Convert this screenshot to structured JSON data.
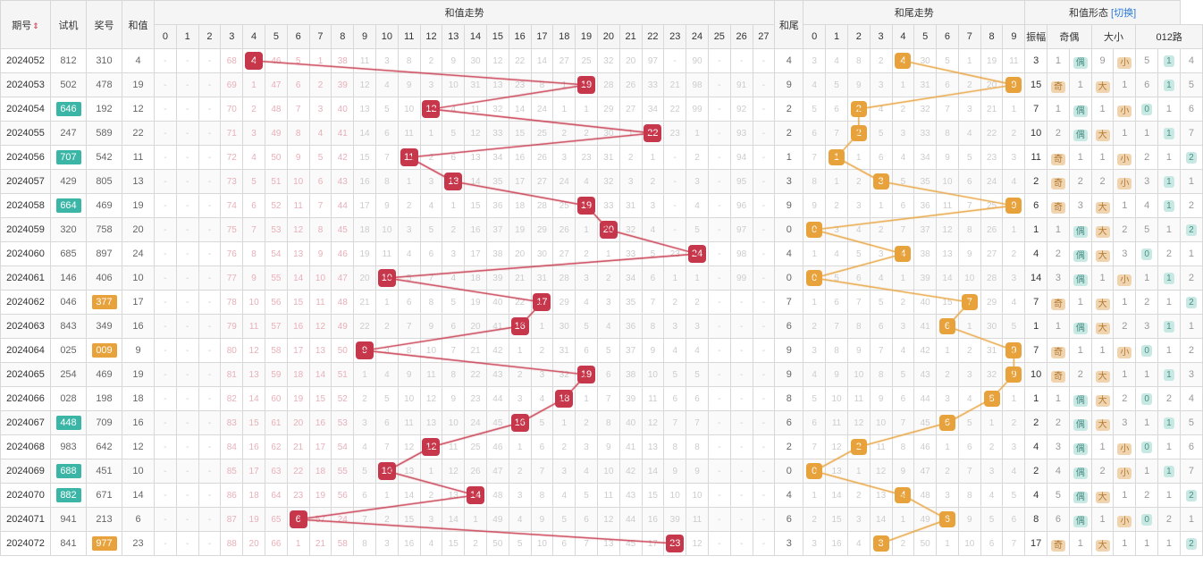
{
  "headers": {
    "period": "期号",
    "sj": "试机",
    "jh": "奖号",
    "hz": "和值",
    "hz_trend": "和值走势",
    "hw": "和尾",
    "hw_trend": "和尾走势",
    "hz_form": "和值形态",
    "switch": "[切换]",
    "zf": "振幅",
    "jo": "奇偶",
    "dx": "大小",
    "r012": "012路"
  },
  "hz_cols": [
    0,
    1,
    2,
    3,
    4,
    5,
    6,
    7,
    8,
    9,
    10,
    11,
    12,
    13,
    14,
    15,
    16,
    17,
    18,
    19,
    20,
    21,
    22,
    23,
    24,
    25,
    26,
    27
  ],
  "hw_cols": [
    0,
    1,
    2,
    3,
    4,
    5,
    6,
    7,
    8,
    9
  ],
  "chart_data": {
    "type": "table",
    "title": "和值走势 / 和尾走势 / 和值形态",
    "columns": [
      "期号",
      "试机",
      "奖号",
      "和值",
      "和尾",
      "振幅",
      "奇偶",
      "大小",
      "012路"
    ],
    "hz_range": [
      0,
      27
    ],
    "hw_range": [
      0,
      9
    ]
  },
  "rows": [
    {
      "period": "2024052",
      "sj": "812",
      "sj_hl": false,
      "jh": "310",
      "jh_hl": false,
      "hz": 4,
      "hz_cells": [
        "-",
        "-",
        "-",
        "68",
        "@4",
        "46",
        "5",
        "1",
        "38",
        "11",
        "3",
        "8",
        "2",
        "9",
        "30",
        "12",
        "22",
        "14",
        "27",
        "25",
        "32",
        "20",
        "97",
        "-",
        "90",
        "-",
        "-",
        "-"
      ],
      "hw": 4,
      "hw_cells": [
        "3",
        "4",
        "8",
        "2",
        "@4",
        "30",
        "5",
        "1",
        "19",
        "11"
      ],
      "zf": 3,
      "jo": [
        "1",
        "偶"
      ],
      "dx": [
        "9",
        "小"
      ],
      "r012": [
        "5",
        "1t",
        "4"
      ]
    },
    {
      "period": "2024053",
      "sj": "502",
      "sj_hl": false,
      "jh": "478",
      "jh_hl": false,
      "hz": 19,
      "hz_cells": [
        "-",
        "-",
        "-",
        "69",
        "1",
        "47",
        "6",
        "2",
        "39",
        "12",
        "4",
        "9",
        "3",
        "10",
        "31",
        "13",
        "23",
        "8",
        "1",
        "@19",
        "28",
        "26",
        "33",
        "21",
        "98",
        "-",
        "91",
        "-"
      ],
      "hw": 9,
      "hw_cells": [
        "4",
        "5",
        "9",
        "3",
        "1",
        "31",
        "6",
        "2",
        "20",
        "@9"
      ],
      "zf": 15,
      "jo": [
        "奇",
        "1"
      ],
      "dx": [
        "大",
        "1"
      ],
      "r012": [
        "6",
        "1t",
        "5"
      ]
    },
    {
      "period": "2024054",
      "sj": "646",
      "sj_hl": true,
      "jh": "192",
      "jh_hl": false,
      "hz": 12,
      "hz_cells": [
        "-",
        "-",
        "-",
        "70",
        "2",
        "48",
        "7",
        "3",
        "40",
        "13",
        "5",
        "10",
        "@12",
        "4",
        "11",
        "32",
        "14",
        "24",
        "1",
        "1",
        "29",
        "27",
        "34",
        "22",
        "99",
        "-",
        "92",
        "-"
      ],
      "hw": 2,
      "hw_cells": [
        "5",
        "6",
        "@2",
        "4",
        "2",
        "32",
        "7",
        "3",
        "21",
        "1"
      ],
      "zf": 7,
      "jo": [
        "1",
        "偶"
      ],
      "dx": [
        "1",
        "小"
      ],
      "r012": [
        "0t",
        "1",
        "6"
      ]
    },
    {
      "period": "2024055",
      "sj": "247",
      "sj_hl": false,
      "jh": "589",
      "jh_hl": false,
      "hz": 22,
      "hz_cells": [
        "-",
        "-",
        "-",
        "71",
        "3",
        "49",
        "8",
        "4",
        "41",
        "14",
        "6",
        "11",
        "1",
        "5",
        "12",
        "33",
        "15",
        "25",
        "2",
        "2",
        "30",
        "1",
        "@22",
        "23",
        "1",
        "-",
        "93",
        "-"
      ],
      "hw": 2,
      "hw_cells": [
        "6",
        "7",
        "@2",
        "5",
        "3",
        "33",
        "8",
        "4",
        "22",
        "2"
      ],
      "zf": 10,
      "jo": [
        "2",
        "偶"
      ],
      "dx": [
        "大",
        "1"
      ],
      "r012": [
        "1",
        "1t",
        "7"
      ]
    },
    {
      "period": "2024056",
      "sj": "707",
      "sj_hl": true,
      "jh": "542",
      "jh_hl": false,
      "hz": 11,
      "hz_cells": [
        "-",
        "-",
        "-",
        "72",
        "4",
        "50",
        "9",
        "5",
        "42",
        "15",
        "7",
        "@11",
        "2",
        "6",
        "13",
        "34",
        "16",
        "26",
        "3",
        "23",
        "31",
        "2",
        "1",
        "-",
        "2",
        "-",
        "94",
        "-"
      ],
      "hw": 1,
      "hw_cells": [
        "7",
        "@1",
        "1",
        "6",
        "4",
        "34",
        "9",
        "5",
        "23",
        "3"
      ],
      "zf": 11,
      "jo": [
        "奇",
        "1"
      ],
      "dx": [
        "1",
        "小"
      ],
      "r012": [
        "2",
        "1",
        "2t"
      ]
    },
    {
      "period": "2024057",
      "sj": "429",
      "sj_hl": false,
      "jh": "805",
      "jh_hl": false,
      "hz": 13,
      "hz_cells": [
        "-",
        "-",
        "-",
        "73",
        "5",
        "51",
        "10",
        "6",
        "43",
        "16",
        "8",
        "1",
        "3",
        "@13",
        "14",
        "35",
        "17",
        "27",
        "24",
        "4",
        "32",
        "3",
        "2",
        "-",
        "3",
        "-",
        "95",
        "-"
      ],
      "hw": 3,
      "hw_cells": [
        "8",
        "1",
        "2",
        "@3",
        "5",
        "35",
        "10",
        "6",
        "24",
        "4"
      ],
      "zf": 2,
      "jo": [
        "奇",
        "2"
      ],
      "dx": [
        "2",
        "小"
      ],
      "r012": [
        "3",
        "1t",
        "1"
      ]
    },
    {
      "period": "2024058",
      "sj": "664",
      "sj_hl": true,
      "jh": "469",
      "jh_hl": false,
      "hz": 19,
      "hz_cells": [
        "-",
        "-",
        "-",
        "74",
        "6",
        "52",
        "11",
        "7",
        "44",
        "17",
        "9",
        "2",
        "4",
        "1",
        "15",
        "36",
        "18",
        "28",
        "25",
        "@19",
        "33",
        "31",
        "3",
        "-",
        "4",
        "-",
        "96",
        "-"
      ],
      "hw": 9,
      "hw_cells": [
        "9",
        "2",
        "3",
        "1",
        "6",
        "36",
        "11",
        "7",
        "25",
        "@9"
      ],
      "zf": 6,
      "jo": [
        "奇",
        "3"
      ],
      "dx": [
        "大",
        "1"
      ],
      "r012": [
        "4",
        "1t",
        "2"
      ]
    },
    {
      "period": "2024059",
      "sj": "320",
      "sj_hl": false,
      "jh": "758",
      "jh_hl": false,
      "hz": 20,
      "hz_cells": [
        "-",
        "-",
        "-",
        "75",
        "7",
        "53",
        "12",
        "8",
        "45",
        "18",
        "10",
        "3",
        "5",
        "2",
        "16",
        "37",
        "19",
        "29",
        "26",
        "1",
        "@20",
        "32",
        "4",
        "-",
        "5",
        "-",
        "97",
        "-"
      ],
      "hw": 0,
      "hw_cells": [
        "@0",
        "3",
        "4",
        "2",
        "7",
        "37",
        "12",
        "8",
        "26",
        "1"
      ],
      "zf": 1,
      "jo": [
        "1",
        "偶"
      ],
      "dx": [
        "大",
        "2"
      ],
      "r012": [
        "5",
        "1",
        "2t"
      ]
    },
    {
      "period": "2024060",
      "sj": "685",
      "sj_hl": false,
      "jh": "897",
      "jh_hl": false,
      "hz": 24,
      "hz_cells": [
        "-",
        "-",
        "-",
        "76",
        "8",
        "54",
        "13",
        "9",
        "46",
        "19",
        "11",
        "4",
        "6",
        "3",
        "17",
        "38",
        "20",
        "30",
        "27",
        "2",
        "1",
        "33",
        "5",
        "23",
        "@24",
        "-",
        "98",
        "-"
      ],
      "hw": 4,
      "hw_cells": [
        "1",
        "4",
        "5",
        "3",
        "@4",
        "38",
        "13",
        "9",
        "27",
        "2"
      ],
      "zf": 4,
      "jo": [
        "2",
        "偶"
      ],
      "dx": [
        "大",
        "3"
      ],
      "r012": [
        "0t",
        "2",
        "1"
      ]
    },
    {
      "period": "2024061",
      "sj": "146",
      "sj_hl": false,
      "jh": "406",
      "jh_hl": false,
      "hz": 10,
      "hz_cells": [
        "-",
        "-",
        "-",
        "77",
        "9",
        "55",
        "14",
        "10",
        "47",
        "20",
        "@10",
        "5",
        "7",
        "4",
        "18",
        "39",
        "21",
        "31",
        "28",
        "3",
        "2",
        "34",
        "6",
        "1",
        "1",
        "-",
        "99",
        "-"
      ],
      "hw": 0,
      "hw_cells": [
        "@0",
        "5",
        "6",
        "4",
        "1",
        "39",
        "14",
        "10",
        "28",
        "3"
      ],
      "zf": 14,
      "jo": [
        "3",
        "偶"
      ],
      "dx": [
        "1",
        "小"
      ],
      "r012": [
        "1",
        "1t",
        "2"
      ]
    },
    {
      "period": "2024062",
      "sj": "046",
      "sj_hl": false,
      "jh": "377",
      "jh_hl": true,
      "hz": 17,
      "hz_cells": [
        "-",
        "-",
        "-",
        "78",
        "10",
        "56",
        "15",
        "11",
        "48",
        "21",
        "1",
        "6",
        "8",
        "5",
        "19",
        "40",
        "22",
        "@17",
        "29",
        "4",
        "3",
        "35",
        "7",
        "2",
        "2",
        "-",
        "-",
        "-"
      ],
      "hw": 7,
      "hw_cells": [
        "1",
        "6",
        "7",
        "5",
        "2",
        "40",
        "15",
        "@7",
        "29",
        "4"
      ],
      "zf": 7,
      "jo": [
        "奇",
        "1"
      ],
      "dx": [
        "大",
        "1"
      ],
      "r012": [
        "2",
        "1",
        "2t"
      ]
    },
    {
      "period": "2024063",
      "sj": "843",
      "sj_hl": false,
      "jh": "349",
      "jh_hl": false,
      "hz": 16,
      "hz_cells": [
        "-",
        "-",
        "-",
        "79",
        "11",
        "57",
        "16",
        "12",
        "49",
        "22",
        "2",
        "7",
        "9",
        "6",
        "20",
        "41",
        "@16",
        "1",
        "30",
        "5",
        "4",
        "36",
        "8",
        "3",
        "3",
        "-",
        "-",
        "-"
      ],
      "hw": 6,
      "hw_cells": [
        "2",
        "7",
        "8",
        "6",
        "3",
        "41",
        "@6",
        "1",
        "30",
        "5"
      ],
      "zf": 1,
      "jo": [
        "1",
        "偶"
      ],
      "dx": [
        "大",
        "2"
      ],
      "r012": [
        "3",
        "1t",
        "1"
      ]
    },
    {
      "period": "2024064",
      "sj": "025",
      "sj_hl": false,
      "jh": "009",
      "jh_hl": true,
      "hz": 9,
      "hz_cells": [
        "-",
        "-",
        "-",
        "80",
        "12",
        "58",
        "17",
        "13",
        "50",
        "@9",
        "3",
        "8",
        "10",
        "7",
        "21",
        "42",
        "1",
        "2",
        "31",
        "6",
        "5",
        "37",
        "9",
        "4",
        "4",
        "-",
        "-",
        "-"
      ],
      "hw": 9,
      "hw_cells": [
        "3",
        "8",
        "9",
        "7",
        "4",
        "42",
        "1",
        "2",
        "31",
        "@9"
      ],
      "zf": 7,
      "jo": [
        "奇",
        "1"
      ],
      "dx": [
        "1",
        "小"
      ],
      "r012": [
        "0t",
        "1",
        "2"
      ]
    },
    {
      "period": "2024065",
      "sj": "254",
      "sj_hl": false,
      "jh": "469",
      "jh_hl": false,
      "hz": 19,
      "hz_cells": [
        "-",
        "-",
        "-",
        "81",
        "13",
        "59",
        "18",
        "14",
        "51",
        "1",
        "4",
        "9",
        "11",
        "8",
        "22",
        "43",
        "2",
        "3",
        "32",
        "@19",
        "6",
        "38",
        "10",
        "5",
        "5",
        "-",
        "-",
        "-"
      ],
      "hw": 9,
      "hw_cells": [
        "4",
        "9",
        "10",
        "8",
        "5",
        "43",
        "2",
        "3",
        "32",
        "@9"
      ],
      "zf": 10,
      "jo": [
        "奇",
        "2"
      ],
      "dx": [
        "大",
        "1"
      ],
      "r012": [
        "1",
        "1t",
        "3"
      ]
    },
    {
      "period": "2024066",
      "sj": "028",
      "sj_hl": false,
      "jh": "198",
      "jh_hl": false,
      "hz": 18,
      "hz_cells": [
        "-",
        "-",
        "-",
        "82",
        "14",
        "60",
        "19",
        "15",
        "52",
        "2",
        "5",
        "10",
        "12",
        "9",
        "23",
        "44",
        "3",
        "4",
        "@18",
        "1",
        "7",
        "39",
        "11",
        "6",
        "6",
        "-",
        "-",
        "-"
      ],
      "hw": 8,
      "hw_cells": [
        "5",
        "10",
        "11",
        "9",
        "6",
        "44",
        "3",
        "4",
        "@8",
        "1"
      ],
      "zf": 1,
      "jo": [
        "1",
        "偶"
      ],
      "dx": [
        "大",
        "2"
      ],
      "r012": [
        "0t",
        "2",
        "4"
      ]
    },
    {
      "period": "2024067",
      "sj": "448",
      "sj_hl": true,
      "jh": "709",
      "jh_hl": false,
      "hz": 16,
      "hz_cells": [
        "-",
        "-",
        "-",
        "83",
        "15",
        "61",
        "20",
        "16",
        "53",
        "3",
        "6",
        "11",
        "13",
        "10",
        "24",
        "45",
        "@16",
        "5",
        "1",
        "2",
        "8",
        "40",
        "12",
        "7",
        "7",
        "-",
        "-",
        "-"
      ],
      "hw": 6,
      "hw_cells": [
        "6",
        "11",
        "12",
        "10",
        "7",
        "45",
        "@6",
        "5",
        "1",
        "2"
      ],
      "zf": 2,
      "jo": [
        "2",
        "偶"
      ],
      "dx": [
        "大",
        "3"
      ],
      "r012": [
        "1",
        "1t",
        "5"
      ]
    },
    {
      "period": "2024068",
      "sj": "983",
      "sj_hl": false,
      "jh": "642",
      "jh_hl": false,
      "hz": 12,
      "hz_cells": [
        "-",
        "-",
        "-",
        "84",
        "16",
        "62",
        "21",
        "17",
        "54",
        "4",
        "7",
        "12",
        "@12",
        "11",
        "25",
        "46",
        "1",
        "6",
        "2",
        "3",
        "9",
        "41",
        "13",
        "8",
        "8",
        "-",
        "-",
        "-"
      ],
      "hw": 2,
      "hw_cells": [
        "7",
        "12",
        "@2",
        "11",
        "8",
        "46",
        "1",
        "6",
        "2",
        "3"
      ],
      "zf": 4,
      "jo": [
        "3",
        "偶"
      ],
      "dx": [
        "1",
        "小"
      ],
      "r012": [
        "0t",
        "1",
        "6"
      ]
    },
    {
      "period": "2024069",
      "sj": "688",
      "sj_hl": true,
      "jh": "451",
      "jh_hl": false,
      "hz": 10,
      "hz_cells": [
        "-",
        "-",
        "-",
        "85",
        "17",
        "63",
        "22",
        "18",
        "55",
        "5",
        "@10",
        "13",
        "1",
        "12",
        "26",
        "47",
        "2",
        "7",
        "3",
        "4",
        "10",
        "42",
        "14",
        "9",
        "9",
        "-",
        "-",
        "-"
      ],
      "hw": 0,
      "hw_cells": [
        "@0",
        "13",
        "1",
        "12",
        "9",
        "47",
        "2",
        "7",
        "3",
        "4"
      ],
      "zf": 2,
      "jo": [
        "4",
        "偶"
      ],
      "dx": [
        "2",
        "小"
      ],
      "r012": [
        "1",
        "1t",
        "7"
      ]
    },
    {
      "period": "2024070",
      "sj": "882",
      "sj_hl": true,
      "jh": "671",
      "jh_hl": false,
      "hz": 14,
      "hz_cells": [
        "-",
        "-",
        "-",
        "86",
        "18",
        "64",
        "23",
        "19",
        "56",
        "6",
        "1",
        "14",
        "2",
        "13",
        "@14",
        "48",
        "3",
        "8",
        "4",
        "5",
        "11",
        "43",
        "15",
        "10",
        "10",
        "-",
        "-",
        "-"
      ],
      "hw": 4,
      "hw_cells": [
        "1",
        "14",
        "2",
        "13",
        "@4",
        "48",
        "3",
        "8",
        "4",
        "5"
      ],
      "zf": 4,
      "jo": [
        "5",
        "偶"
      ],
      "dx": [
        "大",
        "1"
      ],
      "r012": [
        "2",
        "1",
        "2t"
      ]
    },
    {
      "period": "2024071",
      "sj": "941",
      "sj_hl": false,
      "jh": "213",
      "jh_hl": false,
      "hz": 6,
      "hz_cells": [
        "-",
        "-",
        "-",
        "87",
        "19",
        "65",
        "@6",
        "57",
        "24",
        "7",
        "2",
        "15",
        "3",
        "14",
        "1",
        "49",
        "4",
        "9",
        "5",
        "6",
        "12",
        "44",
        "16",
        "39",
        "11",
        "-",
        "-",
        "-"
      ],
      "hw": 6,
      "hw_cells": [
        "2",
        "15",
        "3",
        "14",
        "1",
        "49",
        "@6",
        "9",
        "5",
        "6"
      ],
      "zf": 8,
      "jo": [
        "6",
        "偶"
      ],
      "dx": [
        "1",
        "小"
      ],
      "r012": [
        "0t",
        "2",
        "1"
      ]
    },
    {
      "period": "2024072",
      "sj": "841",
      "sj_hl": false,
      "jh": "977",
      "jh_hl": true,
      "hz": 23,
      "hz_cells": [
        "-",
        "-",
        "-",
        "88",
        "20",
        "66",
        "1",
        "21",
        "58",
        "8",
        "3",
        "16",
        "4",
        "15",
        "2",
        "50",
        "5",
        "10",
        "6",
        "7",
        "13",
        "45",
        "17",
        "@23",
        "12",
        "-",
        "-",
        "-"
      ],
      "hw": 3,
      "hw_cells": [
        "3",
        "16",
        "4",
        "@3",
        "2",
        "50",
        "1",
        "10",
        "6",
        "7"
      ],
      "zf": 17,
      "jo": [
        "奇",
        "1"
      ],
      "dx": [
        "大",
        "1"
      ],
      "r012": [
        "1",
        "1",
        "2t"
      ]
    }
  ]
}
